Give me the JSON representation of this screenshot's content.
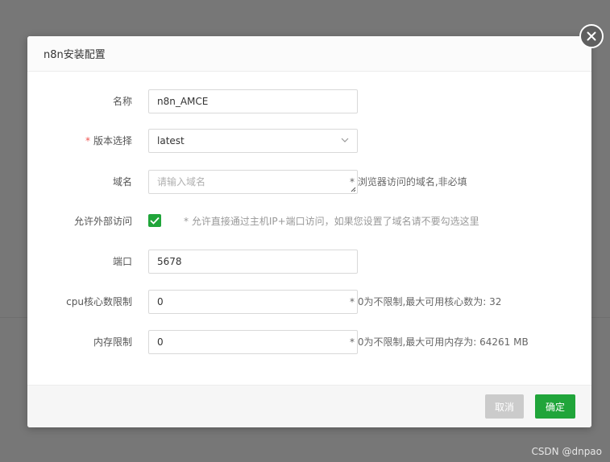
{
  "dialog": {
    "title": "n8n安装配置",
    "close_icon": "close-icon"
  },
  "form": {
    "name": {
      "label": "名称",
      "value": "n8n_AMCE"
    },
    "version": {
      "required_mark": "*",
      "label": "版本选择",
      "value": "latest"
    },
    "domain": {
      "label": "域名",
      "placeholder": "请输入域名",
      "hint": "* 浏览器访问的域名,非必填"
    },
    "external_access": {
      "label": "允许外部访问",
      "checked": true,
      "hint": "* 允许直接通过主机IP+端口访问，如果您设置了域名请不要勾选这里"
    },
    "port": {
      "label": "端口",
      "value": "5678"
    },
    "cpu": {
      "label": "cpu核心数限制",
      "value": "0",
      "hint": "* 0为不限制,最大可用核心数为: 32"
    },
    "memory": {
      "label": "内存限制",
      "value": "0",
      "hint": "* 0为不限制,最大可用内存为: 64261 MB"
    }
  },
  "footer": {
    "cancel_label": "取消",
    "ok_label": "确定"
  },
  "watermark": "CSDN @dnpao",
  "colors": {
    "accent": "#20a53a",
    "required": "#ef5350",
    "overlay": "#777777"
  }
}
